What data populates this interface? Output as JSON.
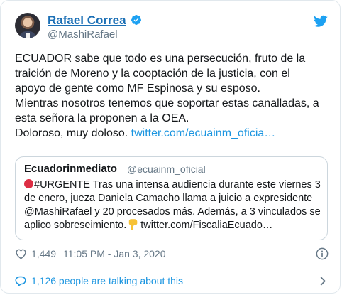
{
  "author": {
    "name": "Rafael Correa",
    "handle": "@MashiRafael",
    "verified": true
  },
  "tweet": {
    "lines": [
      "ECUADOR sabe que todo es una persecución, fruto de la",
      "traición de Moreno  y la cooptación de la justicia, con el",
      "apoyo de gente como  MF Espinosa y su esposo.",
      "Mientras nosotros tenemos que soportar estas canalladas, a",
      "esta señora la proponen a la OEA."
    ],
    "last_line_text": "Doloroso, muy doloso. ",
    "link": "twitter.com/ecuainm_oficia…"
  },
  "quoted": {
    "name": "Ecuadorinmediato",
    "handle": "@ecuainm_oficial",
    "line1": "#URGENTE Tras una intensa audiencia durante este viernes 3",
    "line2": "de enero, jueza Daniela Camacho llama a juicio a expresidente",
    "line3": "@MashiRafael y 20 procesados más. Además, a 3 vinculados se",
    "line4_text": "aplico sobreseimiento.",
    "line4_link": "twitter.com/FiscaliaEcuado…"
  },
  "meta": {
    "likes": "1,449",
    "timestamp": "11:05 PM - Jan 3, 2020"
  },
  "footer": {
    "talking": "1,126 people are talking about this"
  },
  "colors": {
    "link": "#1b95e0",
    "name": "#1b6fb5",
    "muted": "#657786",
    "border": "#e1e8ed"
  }
}
